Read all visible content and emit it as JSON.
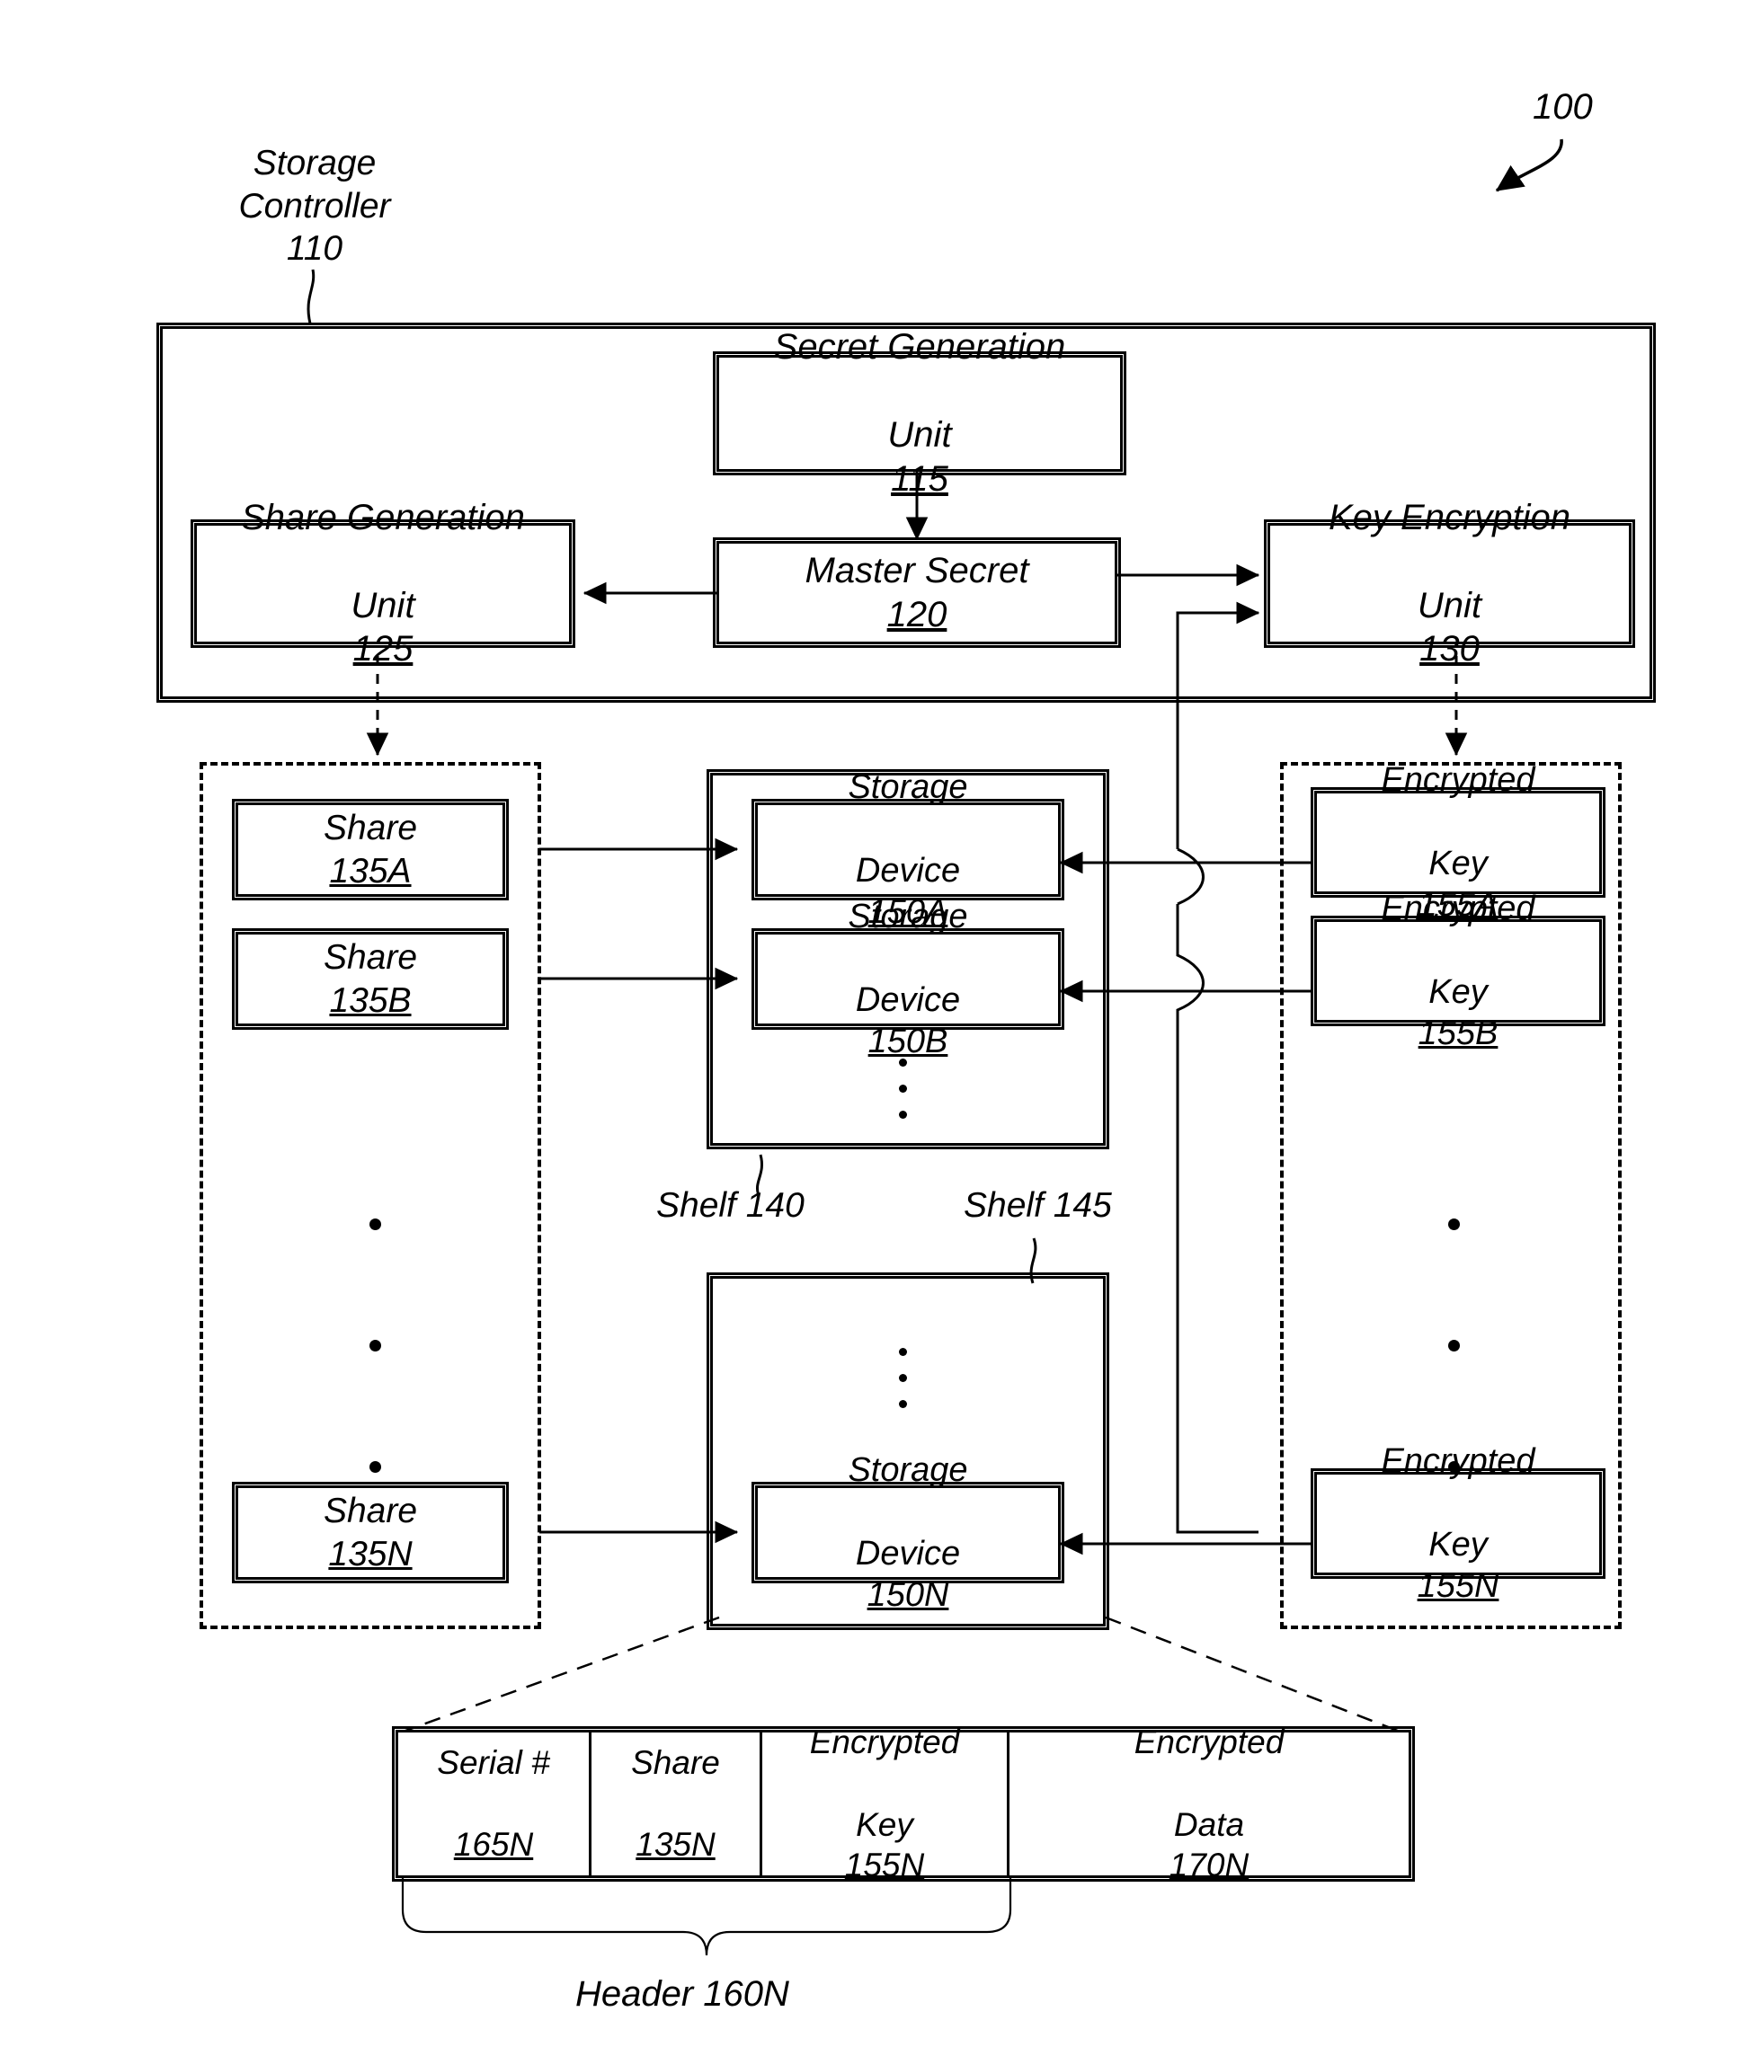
{
  "figure": {
    "number": "100",
    "controller_label": "Storage\nController\n110"
  },
  "controller": {
    "units": [
      {
        "id": "secret-generation-unit",
        "line1": "Secret Generation",
        "line2": "Unit ",
        "ref": "115"
      },
      {
        "id": "share-generation-unit",
        "line1": "Share Generation",
        "line2": "Unit ",
        "ref": "125"
      },
      {
        "id": "master-secret",
        "line1": "",
        "line2": "Master Secret ",
        "ref": "120"
      },
      {
        "id": "key-encryption-unit",
        "line1": "Key Encryption",
        "line2": "Unit ",
        "ref": "130"
      }
    ]
  },
  "shares": {
    "items": [
      {
        "label": "Share ",
        "ref": "135A"
      },
      {
        "label": "Share ",
        "ref": "135B"
      },
      {
        "label": "Share ",
        "ref": "135N"
      }
    ]
  },
  "storage_devices": {
    "items": [
      {
        "line1": "Storage",
        "line2": "Device ",
        "ref": "150A"
      },
      {
        "line1": "Storage",
        "line2": "Device ",
        "ref": "150B"
      },
      {
        "line1": "Storage",
        "line2": "Device ",
        "ref": "150N"
      }
    ]
  },
  "encrypted_keys": {
    "items": [
      {
        "line1": "Encrypted",
        "line2": "Key ",
        "ref": "155A"
      },
      {
        "line1": "Encrypted",
        "line2": "Key ",
        "ref": "155B"
      },
      {
        "line1": "Encrypted",
        "line2": "Key ",
        "ref": "155N"
      }
    ]
  },
  "shelves": [
    {
      "label": "Shelf 140"
    },
    {
      "label": "Shelf 145"
    }
  ],
  "device_layout": {
    "cells": [
      {
        "id": "serial-number",
        "line1": "Serial #",
        "line2": "",
        "ref": "165N"
      },
      {
        "id": "share",
        "line1": "Share",
        "line2": "",
        "ref": "135N"
      },
      {
        "id": "encrypted-key",
        "line1": "Encrypted",
        "line2": "Key ",
        "ref": "155N"
      },
      {
        "id": "encrypted-data",
        "line1": "Encrypted",
        "line2": "Data ",
        "ref": "170N"
      }
    ],
    "brace_label": "Header 160N"
  },
  "colors": {
    "line": "#000000",
    "background": "#ffffff"
  }
}
